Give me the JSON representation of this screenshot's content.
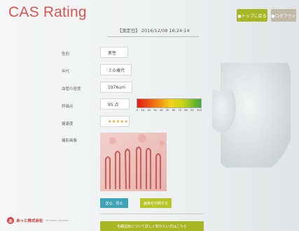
{
  "app": {
    "title": "CAS Rating",
    "buttons": {
      "top": "●トップに戻る",
      "logout": "●ログアウト"
    }
  },
  "measurement": {
    "date_text": "【測定日】 2016/12/08 16:24:14",
    "rows": [
      {
        "label": "性別",
        "value": "男性"
      },
      {
        "label": "年代",
        "value": "３０歳代"
      },
      {
        "label": "血管の密度",
        "value": "1976um"
      },
      {
        "label": "評価点",
        "value": "95 点"
      },
      {
        "label": "健康度",
        "value": "★★★★★"
      },
      {
        "label": "撮影画像",
        "value": ""
      }
    ],
    "scale_ticks": [
      "0",
      "10",
      "20",
      "30",
      "40",
      "50",
      "60",
      "70",
      "80",
      "90",
      "100"
    ],
    "score_percent": 95,
    "rating_stars": 5
  },
  "actions": {
    "mail": "送る、見る",
    "save": "画像を印刷する",
    "info": "毛細血管について詳しく知りたい方はこちら"
  },
  "footer": {
    "logo": "あ",
    "company": "あっと株式会社",
    "copyright": "All rights reserved."
  },
  "colors": {
    "accent": "#d9534f",
    "green": "#a8b624",
    "teal": "#3fa2b5",
    "star": "#e7a31a"
  }
}
